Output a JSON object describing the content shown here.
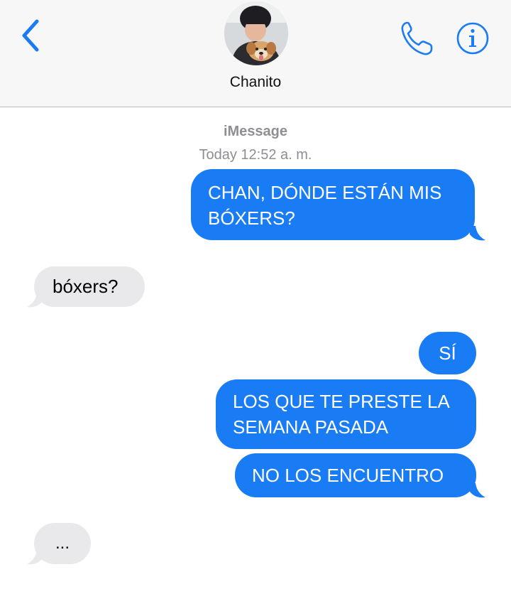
{
  "header": {
    "contact_name": "Chanito",
    "back_icon": "chevron-left-icon",
    "call_icon": "phone-icon",
    "info_icon": "info-icon",
    "accent_color": "#1a7cf5"
  },
  "thread": {
    "service": "iMessage",
    "timestamp": "Today 12:52 a. m.",
    "messages": [
      {
        "from": "me",
        "text": "CHAN, DÓNDE ESTÁN MIS BÓXERS?"
      },
      {
        "from": "contact",
        "text": "bóxers?"
      },
      {
        "from": "me",
        "text": "SÍ"
      },
      {
        "from": "me",
        "text": "LOS QUE TE PRESTE LA SEMANA PASADA"
      },
      {
        "from": "me",
        "text": "NO LOS ENCUENTRO"
      },
      {
        "from": "contact",
        "text": "..."
      }
    ]
  }
}
